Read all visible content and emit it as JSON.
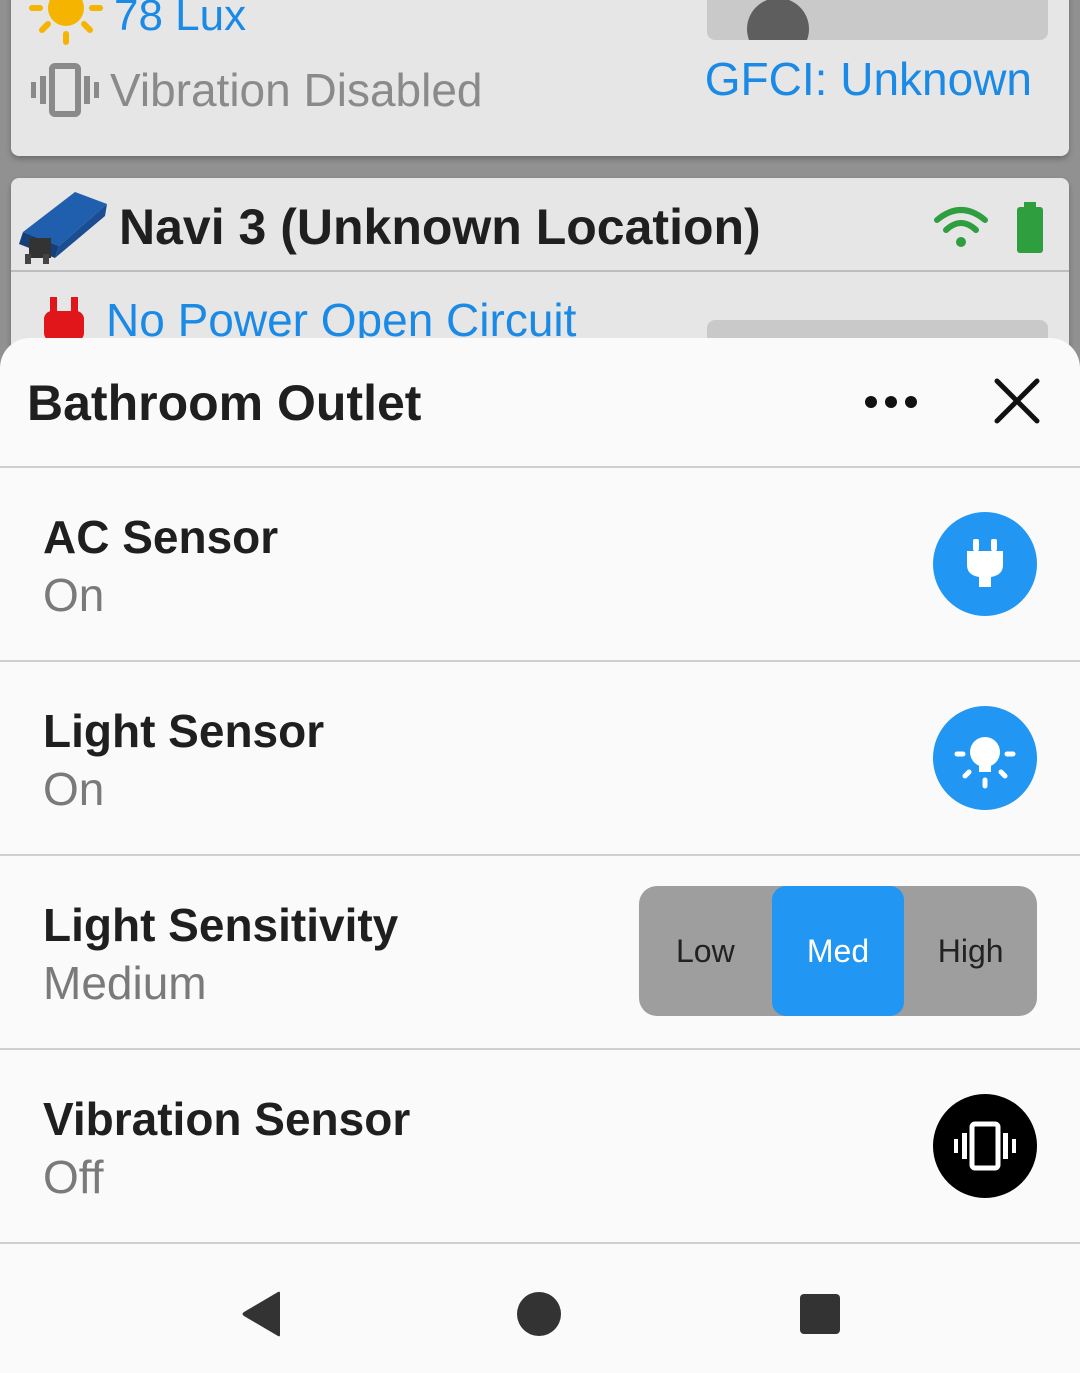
{
  "background": {
    "lux_label": "78 Lux",
    "vibration_label": "Vibration Disabled",
    "gfci_label": "GFCI: Unknown",
    "device_title": "Navi 3 (Unknown Location)",
    "no_power_label": "No Power Open Circuit"
  },
  "sheet": {
    "title": "Bathroom Outlet",
    "more_icon": "more-horizontal-icon",
    "close_icon": "close-icon",
    "rows": [
      {
        "label": "AC Sensor",
        "value": "On",
        "icon": "plug-icon"
      },
      {
        "label": "Light Sensor",
        "value": "On",
        "icon": "light-bulb-icon"
      },
      {
        "label": "Light Sensitivity",
        "value": "Medium",
        "options": [
          "Low",
          "Med",
          "High"
        ],
        "selected": "Med"
      },
      {
        "label": "Vibration Sensor",
        "value": "Off",
        "icon": "vibration-icon"
      }
    ]
  },
  "nav": {
    "back_icon": "back-triangle-icon",
    "home_icon": "home-circle-icon",
    "recents_icon": "recents-square-icon"
  },
  "colors": {
    "accent": "#2196f3",
    "link_blue": "#1a8ae6",
    "sun": "#f5b400",
    "wifi_battery": "#2e9e3e",
    "no_power_red": "#e0161b"
  }
}
